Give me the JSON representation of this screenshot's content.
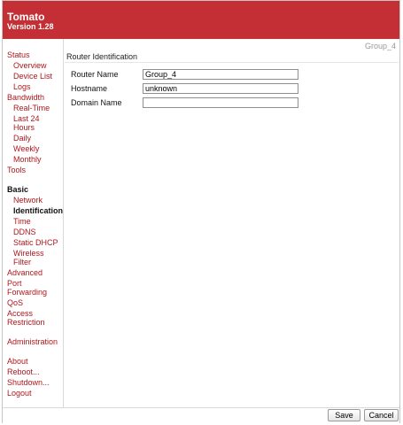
{
  "app": {
    "title": "Tomato",
    "version": "Version 1.28"
  },
  "group_tag": "Group_4",
  "sidebar": {
    "status": "Status",
    "overview": "Overview",
    "device_list": "Device List",
    "logs": "Logs",
    "bandwidth": "Bandwidth",
    "real_time": "Real-Time",
    "last24_line1": "Last 24",
    "last24_line2": "Hours",
    "daily": "Daily",
    "weekly": "Weekly",
    "monthly": "Monthly",
    "tools": "Tools",
    "basic": "Basic",
    "network": "Network",
    "identification": "Identification",
    "time": "Time",
    "ddns": "DDNS",
    "static_dhcp": "Static DHCP",
    "wireless_filter_line1": "Wireless",
    "wireless_filter_line2": "Filter",
    "advanced": "Advanced",
    "port_forwarding_line1": "Port",
    "port_forwarding_line2": "Forwarding",
    "qos": "QoS",
    "access_restriction_line1": "Access",
    "access_restriction_line2": "Restriction",
    "administration": "Administration",
    "about": "About",
    "reboot": "Reboot...",
    "shutdown": "Shutdown...",
    "logout": "Logout"
  },
  "section": {
    "title": "Router Identification",
    "router_name_label": "Router Name",
    "router_name_value": "Group_4",
    "hostname_label": "Hostname",
    "hostname_value": "unknown",
    "domain_name_label": "Domain Name",
    "domain_name_value": ""
  },
  "buttons": {
    "save": "Save",
    "cancel": "Cancel"
  }
}
